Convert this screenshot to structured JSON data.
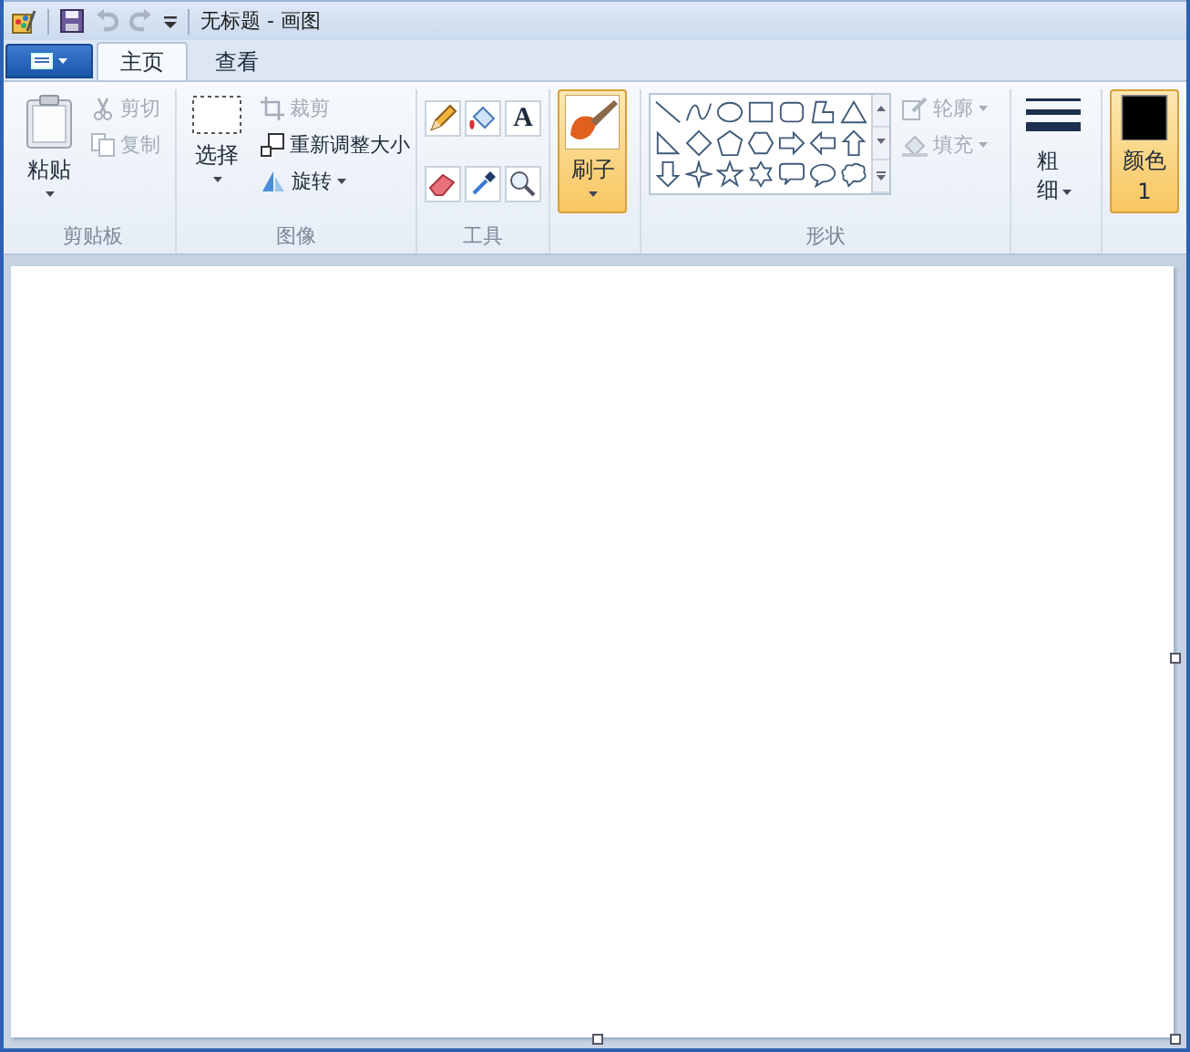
{
  "window": {
    "title": "无标题 - 画图"
  },
  "quick_access": {
    "undo": {
      "disabled": true
    },
    "redo": {
      "disabled": true
    }
  },
  "tabs": [
    {
      "label": "主页",
      "selected": true
    },
    {
      "label": "查看",
      "selected": false
    }
  ],
  "ribbon": {
    "groups": [
      {
        "kind": "clipboard",
        "label": "剪贴板",
        "button": {
          "label": "粘贴"
        },
        "items": [
          {
            "kind": "cut",
            "label": "剪切",
            "disabled": true
          },
          {
            "kind": "copy",
            "label": "复制",
            "disabled": true
          }
        ]
      },
      {
        "kind": "image",
        "label": "图像",
        "button": {
          "label": "选择"
        },
        "items": [
          {
            "kind": "crop",
            "label": "裁剪",
            "disabled": true
          },
          {
            "kind": "resize",
            "label": "重新调整大小",
            "disabled": false
          },
          {
            "kind": "rotate",
            "label": "旋转",
            "disabled": false
          }
        ]
      },
      {
        "kind": "tools",
        "label": "工具",
        "text_tool_glyph": "A"
      },
      {
        "kind": "brushes",
        "button": {
          "label": "刷子",
          "selected": true
        }
      },
      {
        "kind": "shapes",
        "label": "形状",
        "items": [
          {
            "kind": "outline",
            "label": "轮廓",
            "disabled": true
          },
          {
            "kind": "fill",
            "label": "填充",
            "disabled": true
          }
        ]
      },
      {
        "kind": "size",
        "button": {
          "label": "粗细"
        }
      },
      {
        "kind": "colors",
        "button": {
          "label": "颜色 1",
          "selected": true
        }
      }
    ]
  }
}
